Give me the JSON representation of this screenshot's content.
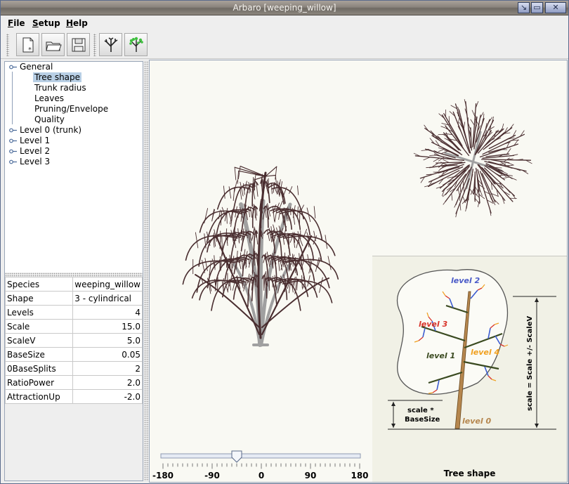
{
  "window": {
    "title": "Arbaro [weeping_willow]"
  },
  "menu": [
    {
      "key": "F",
      "rest": "ile"
    },
    {
      "key": "S",
      "rest": "etup"
    },
    {
      "key": "H",
      "rest": "elp"
    }
  ],
  "toolbar": {
    "buttons": [
      "new-icon",
      "open-icon",
      "save-icon",
      "render-tree-icon",
      "render-leaves-icon"
    ]
  },
  "tree": {
    "general": "General",
    "children": [
      "Tree shape",
      "Trunk radius",
      "Leaves",
      "Pruning/Envelope",
      "Quality"
    ],
    "levels": [
      "Level 0 (trunk)",
      "Level 1",
      "Level 2",
      "Level 3"
    ],
    "selected": "Tree shape"
  },
  "params": [
    {
      "name": "Species",
      "value": "weeping_willow",
      "num": false
    },
    {
      "name": "Shape",
      "value": "3 - cylindrical",
      "num": false
    },
    {
      "name": "Levels",
      "value": "4",
      "num": true
    },
    {
      "name": "Scale",
      "value": "15.0",
      "num": true
    },
    {
      "name": "ScaleV",
      "value": "5.0",
      "num": true
    },
    {
      "name": "BaseSize",
      "value": "0.05",
      "num": true
    },
    {
      "name": "0BaseSplits",
      "value": "2",
      "num": true
    },
    {
      "name": "RatioPower",
      "value": "2.0",
      "num": true
    },
    {
      "name": "AttractionUp",
      "value": "-2.0",
      "num": true
    }
  ],
  "help": {
    "caption": "Tree shape",
    "labels": {
      "level0": "level 0",
      "level1": "level 1",
      "level2": "level 2",
      "level3": "level 3",
      "level4": "level 4",
      "scale_base_1": "scale *",
      "scale_base_2": "BaseSize",
      "scale_formula": "scale = Scale +/- ScaleV"
    }
  },
  "rotation": {
    "min": -180,
    "max": 180,
    "value": -45,
    "tick_labels": [
      "-180",
      "-90",
      "0",
      "90",
      "180"
    ]
  },
  "colors": {
    "branch": "#4a2e30",
    "trunk": "#a0a0a0",
    "selection": "#b8cfe5"
  }
}
